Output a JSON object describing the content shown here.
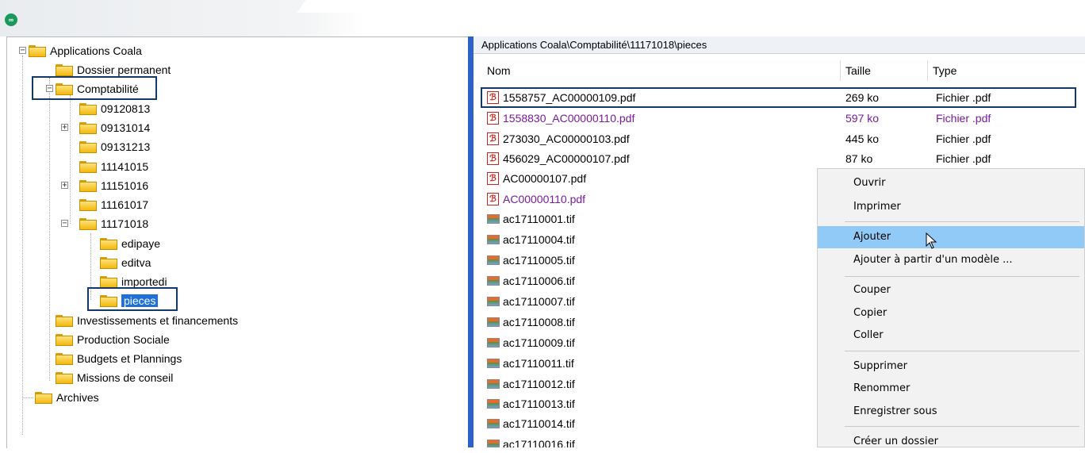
{
  "app": {
    "logo_icon": "coala-infinity-logo-icon"
  },
  "tree": {
    "root": "Applications Coala",
    "dossier_permanent": "Dossier permanent",
    "comptabilite": "Comptabilité",
    "years": [
      "09120813",
      "09131014",
      "09131213",
      "11141015",
      "11151016",
      "11161017",
      "11171018"
    ],
    "sub": [
      "edipaye",
      "editva",
      "importedi",
      "pieces"
    ],
    "others": [
      "Investissements et financements",
      "Production Sociale",
      "Budgets et Plannings",
      "Missions de conseil"
    ],
    "archives": "Archives"
  },
  "list": {
    "path": "Applications Coala\\Comptabilité\\11171018\\pieces",
    "headers": {
      "name": "Nom",
      "size": "Taille",
      "type": "Type"
    },
    "rows": [
      {
        "name": "1558757_AC00000109.pdf",
        "size": "269 ko",
        "type": "Fichier .pdf"
      },
      {
        "name": "1558830_AC00000110.pdf",
        "size": "597 ko",
        "type": "Fichier .pdf"
      },
      {
        "name": "273030_AC00000103.pdf",
        "size": "445 ko",
        "type": "Fichier .pdf"
      },
      {
        "name": "456029_AC00000107.pdf",
        "size": "87 ko",
        "type": "Fichier .pdf"
      },
      {
        "name": "AC00000107.pdf"
      },
      {
        "name": "AC00000110.pdf"
      },
      {
        "name": "ac17110001.tif"
      },
      {
        "name": "ac17110004.tif"
      },
      {
        "name": "ac17110005.tif"
      },
      {
        "name": "ac17110006.tif"
      },
      {
        "name": "ac17110007.tif"
      },
      {
        "name": "ac17110008.tif"
      },
      {
        "name": "ac17110009.tif"
      },
      {
        "name": "ac17110011.tif"
      },
      {
        "name": "ac17110012.tif"
      },
      {
        "name": "ac17110013.tif"
      },
      {
        "name": "ac17110014.tif"
      },
      {
        "name": "ac17110016.tif"
      }
    ]
  },
  "menu": {
    "ouvrir": "Ouvrir",
    "imprimer": "Imprimer",
    "ajouter": "Ajouter",
    "ajouter_modele": "Ajouter à partir d'un modèle ...",
    "couper": "Couper",
    "copier": "Copier",
    "coller": "Coller",
    "supprimer": "Supprimer",
    "renommer": "Renommer",
    "enregistrer": "Enregistrer sous",
    "creer_dossier": "Créer un dossier"
  },
  "colors": {
    "selection": "#1e71d6",
    "highlight_box": "#123a64",
    "splitter": "#2c61c9",
    "menu_hover": "#91c9f7",
    "purple_text": "#7a1b9a"
  }
}
